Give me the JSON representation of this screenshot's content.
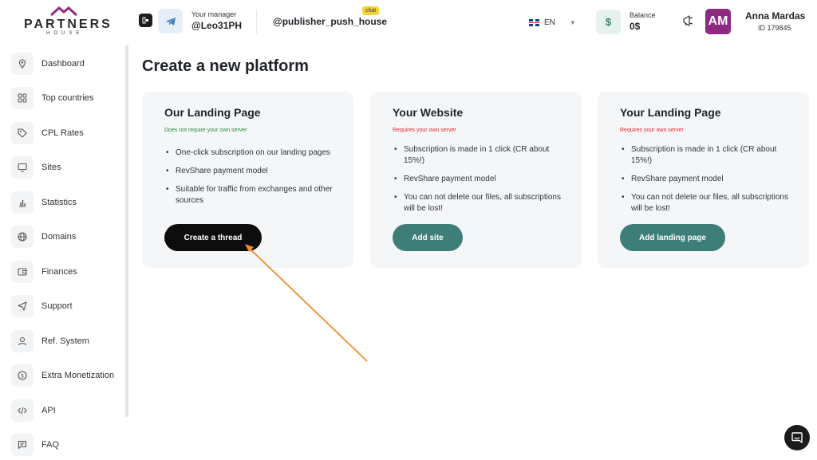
{
  "brand": {
    "name": "PARTNERS",
    "sub": "HOUSE",
    "roof_color": "#8e2a82"
  },
  "header": {
    "manager_label": "Your manager",
    "manager_handle": "@Leo31PH",
    "publisher_handle": "@publisher_push_house",
    "chat_badge": "chat",
    "language": "EN",
    "balance_label": "Balance",
    "balance_value": "0$",
    "balance_icon": "$",
    "avatar_initials": "AM",
    "user_name": "Anna Mardas",
    "user_id": "ID 179845"
  },
  "sidebar": {
    "items": [
      {
        "label": "Dashboard",
        "icon": "map-pin-icon"
      },
      {
        "label": "Top countries",
        "icon": "grid-icon"
      },
      {
        "label": "CPL Rates",
        "icon": "tag-icon"
      },
      {
        "label": "Sites",
        "icon": "monitor-icon"
      },
      {
        "label": "Statistics",
        "icon": "bar-chart-icon"
      },
      {
        "label": "Domains",
        "icon": "globe-icon"
      },
      {
        "label": "Finances",
        "icon": "wallet-icon"
      },
      {
        "label": "Support",
        "icon": "send-icon"
      },
      {
        "label": "Ref. System",
        "icon": "user-icon"
      },
      {
        "label": "Extra Monetization",
        "icon": "dollar-icon"
      },
      {
        "label": "API",
        "icon": "code-icon"
      },
      {
        "label": "FAQ",
        "icon": "message-icon"
      }
    ]
  },
  "main": {
    "title": "Create a new platform",
    "cards": [
      {
        "title": "Our Landing Page",
        "note": "Does not require your own server",
        "bullets": [
          "One-click subscription on our landing pages",
          "RevShare payment model",
          "Suitable for traffic from exchanges and other sources"
        ],
        "button": "Create a thread"
      },
      {
        "title": "Your Website",
        "note": "Requires your own server",
        "bullets": [
          "Subscription is made in 1 click (CR about 15%!)",
          "RevShare payment model",
          "You can not delete our files, all subscriptions will be lost!"
        ],
        "button": "Add site"
      },
      {
        "title": "Your Landing Page",
        "note": "Requires your own server",
        "bullets": [
          "Subscription is made in 1 click (CR about 15%!)",
          "RevShare payment model",
          "You can not delete our files, all subscriptions will be lost!"
        ],
        "button": "Add landing page"
      }
    ]
  },
  "colors": {
    "accent_teal": "#3d7f78",
    "note_green": "#2e8b3f",
    "note_red": "#e0272c",
    "arrow": "#f28c28"
  }
}
